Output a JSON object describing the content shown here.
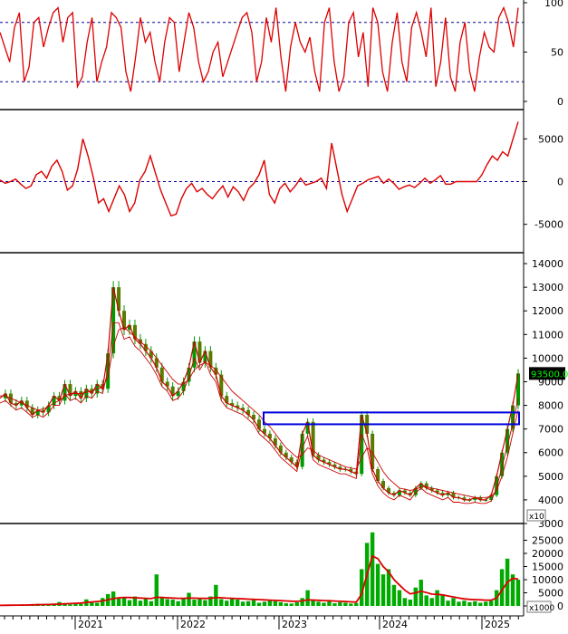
{
  "chart_data": [
    {
      "type": "line",
      "panel": "oscillator",
      "yticks": [
        "100",
        "50",
        "0"
      ],
      "ylim": [
        0,
        100
      ],
      "reference_lines": [
        80,
        20
      ],
      "series": [
        {
          "values": [
            70,
            55,
            40,
            75,
            90,
            20,
            35,
            80,
            85,
            55,
            75,
            90,
            95,
            60,
            85,
            90,
            15,
            25,
            60,
            85,
            20,
            40,
            55,
            90,
            85,
            75,
            30,
            10,
            45,
            85,
            60,
            70,
            40,
            20,
            60,
            85,
            80,
            30,
            60,
            90,
            75,
            40,
            20,
            30,
            50,
            60,
            25,
            40,
            55,
            70,
            85,
            90,
            70,
            20,
            40,
            85,
            60,
            95,
            45,
            10,
            55,
            80,
            60,
            50,
            65,
            30,
            10,
            80,
            95,
            40,
            10,
            25,
            80,
            90,
            45,
            70,
            15,
            95,
            80,
            30,
            10,
            60,
            90,
            40,
            20,
            75,
            90,
            70,
            45,
            95,
            15,
            40,
            85,
            25,
            10,
            60,
            80,
            30,
            10,
            45,
            70,
            55,
            50,
            85,
            95,
            80,
            55,
            95
          ]
        }
      ]
    },
    {
      "type": "line",
      "panel": "momentum",
      "yticks": [
        "5000",
        "0",
        "-5000"
      ],
      "ylim": [
        -8000,
        8000
      ],
      "reference_lines": [
        0
      ],
      "series": [
        {
          "values": [
            200,
            -200,
            0,
            300,
            -300,
            -800,
            -500,
            800,
            1200,
            400,
            1800,
            2500,
            1200,
            -1000,
            -500,
            1500,
            5000,
            3000,
            500,
            -2500,
            -2000,
            -3500,
            -2000,
            -500,
            -1500,
            -3500,
            -2500,
            200,
            1200,
            3000,
            1000,
            -1000,
            -2500,
            -4000,
            -3800,
            -2000,
            -800,
            -200,
            -1200,
            -800,
            -1500,
            -2000,
            -1200,
            -500,
            -1800,
            -600,
            -1200,
            -2200,
            -800,
            -200,
            800,
            2500,
            -1500,
            -2500,
            -800,
            -200,
            -1200,
            -500,
            400,
            -400,
            -200,
            0,
            400,
            -800,
            4500,
            1500,
            -1500,
            -3500,
            -2000,
            -500,
            -200,
            200,
            400,
            600,
            -200,
            300,
            -200,
            -900,
            -600,
            -400,
            -700,
            -200,
            400,
            -200,
            200,
            700,
            -300,
            -300,
            0,
            0,
            0,
            0,
            0,
            800,
            2000,
            3000,
            2500,
            3500,
            3000,
            5000,
            7000
          ]
        }
      ]
    },
    {
      "type": "line",
      "panel": "price",
      "title": "",
      "xlabel": "",
      "ylabel": "",
      "x": [
        "2021",
        "2022",
        "2023",
        "2024",
        "2025"
      ],
      "yticks": [
        "14000",
        "13000",
        "12000",
        "11000",
        "10000",
        "9000",
        "8000",
        "7000",
        "6000",
        "5000",
        "4000",
        "3000"
      ],
      "ylim": [
        3000,
        14500
      ],
      "last_price_label": "93500.0",
      "axis_multiplier": "x10",
      "highlight_box": {
        "y_low": 7200,
        "y_high": 7700
      },
      "series": [
        {
          "values": [
            8300,
            8500,
            8100,
            8000,
            8200,
            7900,
            7600,
            7800,
            7700,
            8000,
            8400,
            8200,
            8900,
            8400,
            8600,
            8300,
            8700,
            8500,
            8900,
            8700,
            10200,
            13000,
            12000,
            11200,
            11400,
            10800,
            10600,
            10300,
            10000,
            9600,
            9000,
            8800,
            8400,
            8600,
            9000,
            9600,
            10700,
            9800,
            10300,
            9600,
            9300,
            8400,
            8100,
            8000,
            7900,
            7800,
            7600,
            7400,
            7000,
            6800,
            6600,
            6300,
            6000,
            5800,
            5600,
            5400,
            6800,
            7300,
            5900,
            5700,
            5600,
            5500,
            5400,
            5300,
            5300,
            5200,
            5100,
            7600,
            6800,
            5300,
            4800,
            4500,
            4300,
            4200,
            4400,
            4300,
            4200,
            4500,
            4700,
            4500,
            4400,
            4300,
            4200,
            4300,
            4100,
            4100,
            4000,
            4000,
            4100,
            4000,
            4000,
            4200,
            5000,
            6000,
            7000,
            8000,
            9350
          ]
        },
        {
          "values": [
            8400,
            8400,
            8300,
            8200,
            8100,
            8000,
            7900,
            7800,
            7850,
            7950,
            8100,
            8200,
            8400,
            8500,
            8500,
            8500,
            8550,
            8600,
            8700,
            8750,
            9200,
            10500,
            11200,
            11300,
            11100,
            10900,
            10700,
            10500,
            10300,
            10000,
            9700,
            9400,
            9100,
            8900,
            8900,
            9100,
            9500,
            9700,
            9800,
            9700,
            9500,
            9200,
            8900,
            8600,
            8400,
            8200,
            8000,
            7800,
            7600,
            7300,
            7100,
            6800,
            6500,
            6200,
            6000,
            5800,
            5900,
            6200,
            6100,
            5900,
            5800,
            5700,
            5600,
            5500,
            5400,
            5350,
            5300,
            5800,
            6200,
            6000,
            5600,
            5200,
            4900,
            4700,
            4500,
            4450,
            4400,
            4450,
            4550,
            4550,
            4500,
            4450,
            4400,
            4350,
            4300,
            4250,
            4200,
            4150,
            4100,
            4100,
            4100,
            4150,
            4400,
            5000,
            5800,
            6800,
            7800
          ]
        },
        {
          "values": [
            8100,
            8200,
            8000,
            7800,
            7900,
            7700,
            7500,
            7600,
            7500,
            7700,
            8000,
            8000,
            8500,
            8200,
            8300,
            8100,
            8400,
            8300,
            8600,
            8500,
            9500,
            11500,
            11500,
            10800,
            10900,
            10500,
            10300,
            10000,
            9700,
            9300,
            8800,
            8600,
            8200,
            8300,
            8600,
            9200,
            10000,
            9500,
            9900,
            9300,
            9000,
            8200,
            7900,
            7800,
            7700,
            7600,
            7400,
            7200,
            6800,
            6600,
            6400,
            6100,
            5800,
            5600,
            5400,
            5200,
            6200,
            6700,
            5700,
            5500,
            5400,
            5300,
            5200,
            5100,
            5100,
            5000,
            4900,
            6800,
            6200,
            5100,
            4600,
            4300,
            4100,
            4000,
            4200,
            4100,
            4000,
            4300,
            4500,
            4300,
            4200,
            4100,
            4000,
            4100,
            3900,
            3900,
            3850,
            3850,
            3900,
            3850,
            3850,
            3950,
            4500,
            5400,
            6300,
            7200,
            8300
          ]
        }
      ]
    },
    {
      "type": "bar",
      "panel": "volume",
      "yticks": [
        "25000",
        "20000",
        "15000",
        "10000",
        "5000",
        "0"
      ],
      "ylim": [
        0,
        30000
      ],
      "axis_multiplier": "x1000",
      "series": [
        {
          "values": [
            300,
            500,
            200,
            400,
            600,
            300,
            500,
            800,
            400,
            600,
            700,
            1500,
            900,
            600,
            1200,
            800,
            2500,
            1600,
            1200,
            3000,
            4500,
            5500,
            2800,
            3400,
            2200,
            3600,
            2000,
            2600,
            1800,
            12000,
            3000,
            2600,
            2400,
            1800,
            2800,
            5000,
            2400,
            3000,
            2200,
            3600,
            8000,
            2600,
            2000,
            2800,
            2400,
            1600,
            1800,
            2200,
            1200,
            1600,
            2000,
            1800,
            1400,
            1000,
            900,
            1400,
            3000,
            6000,
            2400,
            1600,
            1200,
            1800,
            1000,
            1400,
            1200,
            900,
            1100,
            14000,
            24000,
            28000,
            16000,
            12000,
            14000,
            8000,
            6000,
            3000,
            2400,
            7000,
            10000,
            4000,
            3000,
            6000,
            4000,
            2000,
            3000,
            1600,
            2000,
            1400,
            1800,
            1200,
            1600,
            2000,
            6000,
            14000,
            18000,
            12000,
            10000
          ]
        },
        {
          "values": [
            200,
            250,
            280,
            300,
            320,
            360,
            400,
            450,
            500,
            560,
            620,
            700,
            800,
            900,
            1000,
            1100,
            1300,
            1500,
            1700,
            1900,
            2300,
            2800,
            3100,
            3200,
            3200,
            3100,
            3000,
            2900,
            2800,
            3300,
            3200,
            3100,
            3000,
            2900,
            2900,
            3000,
            2950,
            2900,
            2850,
            2900,
            3200,
            3100,
            2950,
            2900,
            2800,
            2700,
            2600,
            2500,
            2400,
            2300,
            2200,
            2100,
            2000,
            1900,
            1800,
            1750,
            1900,
            2300,
            2250,
            2150,
            2050,
            1950,
            1850,
            1750,
            1650,
            1550,
            1450,
            4500,
            12000,
            19000,
            18000,
            15000,
            13000,
            10000,
            8000,
            6000,
            4600,
            5000,
            5600,
            5100,
            4500,
            4400,
            4200,
            3800,
            3400,
            3000,
            2700,
            2500,
            2400,
            2300,
            2200,
            2200,
            3000,
            6000,
            9000,
            10500,
            10200
          ]
        }
      ]
    }
  ],
  "colors": {
    "price_line": "#cc0000",
    "oscillator_line": "#dd0000",
    "reference_line": "#000099",
    "highlight_box": "#0000dd",
    "candle_up": "#009900",
    "volume_bar": "#00aa00",
    "volume_ma": "#dd0000",
    "panel_separator": "#444444",
    "price_tag_bg": "#000000",
    "price_tag_text": "#00ff00"
  }
}
